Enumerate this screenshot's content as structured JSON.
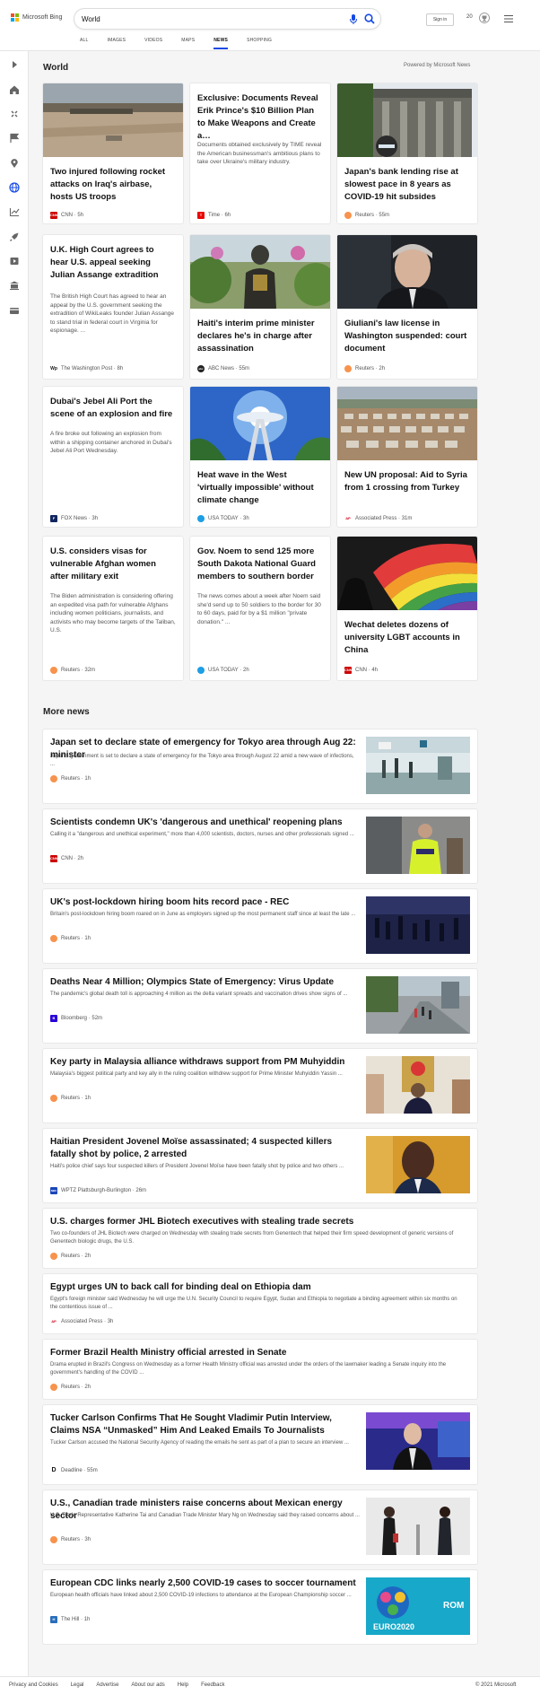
{
  "brand": {
    "name": "Microsoft Bing"
  },
  "search": {
    "value": "World"
  },
  "header": {
    "signin_label": "Sign in",
    "rewards_count": "20"
  },
  "tabs": [
    {
      "label": "ALL",
      "active": false
    },
    {
      "label": "IMAGES",
      "active": false
    },
    {
      "label": "VIDEOS",
      "active": false
    },
    {
      "label": "MAPS",
      "active": false
    },
    {
      "label": "NEWS",
      "active": true
    },
    {
      "label": "SHOPPING",
      "active": false
    }
  ],
  "world": {
    "title": "World",
    "powered": "Powered by Microsoft News"
  },
  "cards": [
    {
      "title": "Two injured following rocket attacks on Iraq's airbase, hosts US troops",
      "snippet": "",
      "source": "CNN",
      "time": "5h",
      "favicon": "CNN",
      "fav_color": "#cc0000",
      "image": "desert"
    },
    {
      "title": "Exclusive: Documents Reveal Erik Prince's $10 Billion Plan to Make Weapons and Create a…",
      "snippet": "Documents obtained exclusively by TIME reveal the American businessman's ambitious plans to take over Ukraine's military industry.",
      "source": "Time",
      "time": "6h",
      "favicon": "T",
      "fav_color": "#e90606",
      "image": ""
    },
    {
      "title": "Japan's bank lending rise at slowest pace in 8 years as COVID-19 hit subsides",
      "snippet": "",
      "source": "Reuters",
      "time": "55m",
      "favicon": "R",
      "fav_color": "#f7934c",
      "image": "bank"
    },
    {
      "title": "U.K. High Court agrees to hear U.S. appeal seeking Julian Assange extradition",
      "snippet": "The British High Court has agreed to hear an appeal by the U.S. government seeking the extradition of WikiLeaks founder Julian Assange to stand trial in federal court in Virginia for espionage. ...",
      "source": "The Washington Post",
      "time": "8h",
      "favicon": "Wp",
      "fav_color": "#111111",
      "image": ""
    },
    {
      "title": "Haiti's interim prime minister declares he's in charge after assassination",
      "snippet": "",
      "source": "ABC News",
      "time": "55m",
      "favicon": "abc",
      "fav_color": "#222222",
      "image": "soldier"
    },
    {
      "title": "Giuliani's law license in Washington suspended: court document",
      "snippet": "",
      "source": "Reuters",
      "time": "2h",
      "favicon": "R",
      "fav_color": "#f7934c",
      "image": "giuliani"
    },
    {
      "title": "Dubai's Jebel Ali Port the scene of an explosion and fire",
      "snippet": "A fire broke out following an explosion from within a shipping container anchored in Dubai's Jebel Ali Port Wednesday.",
      "source": "FOX News",
      "time": "3h",
      "favicon": "F",
      "fav_color": "#13275f",
      "image": ""
    },
    {
      "title": "Heat wave in the West 'virtually impossible' without climate change",
      "snippet": "",
      "source": "USA TODAY",
      "time": "3h",
      "favicon": "",
      "fav_color": "#1d9ee5",
      "image": "needle"
    },
    {
      "title": "New UN proposal: Aid to Syria from 1 crossing from Turkey",
      "snippet": "",
      "source": "Associated Press",
      "time": "31m",
      "favicon": "AP",
      "fav_color": "#d0021b",
      "image": "camp"
    },
    {
      "title": "U.S. considers visas for vulnerable Afghan women after military exit",
      "snippet": "The Biden administration is considering offering an expedited visa path for vulnerable Afghans including women politicians, journalists, and activists who may become targets of the Taliban, U.S.",
      "source": "Reuters",
      "time": "32m",
      "favicon": "R",
      "fav_color": "#f7934c",
      "image": ""
    },
    {
      "title": "Gov. Noem to send 125 more South Dakota National Guard members to southern border",
      "snippet": "The news comes about a week after Noem said she'd send up to 50 soldiers to the border for 30 to 60 days, paid for by a $1 million \"private donation.\" ...",
      "source": "USA TODAY",
      "time": "2h",
      "favicon": "",
      "fav_color": "#1d9ee5",
      "image": ""
    },
    {
      "title": "Wechat deletes dozens of university LGBT accounts in China",
      "snippet": "",
      "source": "CNN",
      "time": "4h",
      "favicon": "CNN",
      "fav_color": "#cc0000",
      "image": "flag"
    }
  ],
  "more": {
    "title": "More news"
  },
  "rows": [
    {
      "title": "Japan set to declare state of emergency for Tokyo area through Aug 22: minister",
      "snippet": "Japan's government is set to declare a state of emergency for the Tokyo area through August 22 amid a new wave of infections, ...",
      "source": "Reuters",
      "time": "1h",
      "favicon": "R",
      "fav_color": "#f7934c",
      "thumb": "airport"
    },
    {
      "title": "Scientists condemn UK's 'dangerous and unethical' reopening plans",
      "snippet": "Calling it a \"dangerous and unethical experiment,\" more than 4,000 scientists, doctors, nurses and other professionals signed ...",
      "source": "CNN",
      "time": "2h",
      "favicon": "CNN",
      "fav_color": "#cc0000",
      "thumb": "police"
    },
    {
      "title": "UK's post-lockdown hiring boom hits record pace - REC",
      "snippet": "Britain's post-lockdown hiring boom roared on in June as employers signed up the most permanent staff since at least the late ...",
      "source": "Reuters",
      "time": "1h",
      "favicon": "R",
      "fav_color": "#f7934c",
      "thumb": "crowd"
    },
    {
      "title": "Deaths Near 4 Million; Olympics State of Emergency: Virus Update",
      "snippet": "The pandemic's global death toll is approaching 4 million as the delta variant spreads and vaccination drives show signs of ...",
      "source": "Bloomberg",
      "time": "52m",
      "favicon": "B",
      "fav_color": "#2800d7",
      "thumb": "street"
    },
    {
      "title": "Key party in Malaysia alliance withdraws support from PM Muhyiddin",
      "snippet": "Malaysia's biggest political party and key ally in the ruling coalition withdrew support for Prime Minister Muhyiddin Yassin ...",
      "source": "Reuters",
      "time": "1h",
      "favicon": "R",
      "fav_color": "#f7934c",
      "thumb": "malaysia"
    },
    {
      "title": "Haitian President Jovenel Moïse assassinated; 4 suspected killers fatally shot by police, 2 arrested",
      "snippet": "Haiti's police chief says four suspected killers of President Jovenel Moïse have been fatally shot by police and two others ...",
      "source": "WPTZ Plattsburgh-Burlington",
      "time": "26m",
      "favicon": "NBC",
      "fav_color": "#1a47b8",
      "thumb": "moise"
    },
    {
      "title": "U.S. charges former JHL Biotech executives with stealing trade secrets",
      "snippet": "Two co-founders of JHL Biotech were charged on Wednesday with stealing trade secrets from Genentech that helped their firm speed development of generic versions of Genentech biologic drugs, the U.S.",
      "source": "Reuters",
      "time": "2h",
      "favicon": "R",
      "fav_color": "#f7934c",
      "thumb": ""
    },
    {
      "title": "Egypt urges UN to back call for binding deal on Ethiopia dam",
      "snippet": "Egypt's foreign minister said Wednesday he will urge the U.N. Security Council to require Egypt, Sudan and Ethiopia to negotiate a binding agreement within six months on the contentious issue of ...",
      "source": "Associated Press",
      "time": "3h",
      "favicon": "AP",
      "fav_color": "#d0021b",
      "thumb": ""
    },
    {
      "title": "Former Brazil Health Ministry official arrested in Senate",
      "snippet": "Drama erupted in Brazil's Congress on Wednesday as a former Health Ministry official was arrested under the orders of the lawmaker leading a Senate inquiry into the government's handling of the COVID ...",
      "source": "Reuters",
      "time": "2h",
      "favicon": "R",
      "fav_color": "#f7934c",
      "thumb": ""
    },
    {
      "title": "Tucker Carlson Confirms That He Sought Vladimir Putin Interview, Claims NSA “Unmasked” Him And Leaked Emails To Journalists",
      "snippet": "Tucker Carlson accused the National Security Agency of reading the emails he sent as part of a plan to secure an interview ...",
      "source": "Deadline",
      "time": "55m",
      "favicon": "D",
      "fav_color": "#111111",
      "thumb": "tucker"
    },
    {
      "title": "U.S., Canadian trade ministers raise concerns about Mexican energy sector",
      "snippet": "U.S. Trade Representative Katherine Tai and Canadian Trade Minister Mary Ng on Wednesday said they raised concerns about ...",
      "source": "Reuters",
      "time": "3h",
      "favicon": "R",
      "fav_color": "#f7934c",
      "thumb": "ministers"
    },
    {
      "title": "European CDC links nearly 2,500 COVID-19 cases to soccer tournament",
      "snippet": "European health officials have linked about 2,500 COVID-19 infections to attendance at the European Championship soccer ...",
      "source": "The Hill",
      "time": "1h",
      "favicon": "H",
      "fav_color": "#2a6ebb",
      "thumb": "euro"
    }
  ],
  "euro_badge": {
    "text": "EURO2020",
    "side": "ROM"
  },
  "footer": {
    "links": [
      "Privacy and Cookies",
      "Legal",
      "Advertise",
      "About our ads",
      "Help",
      "Feedback"
    ],
    "copyright": "© 2021 Microsoft"
  }
}
